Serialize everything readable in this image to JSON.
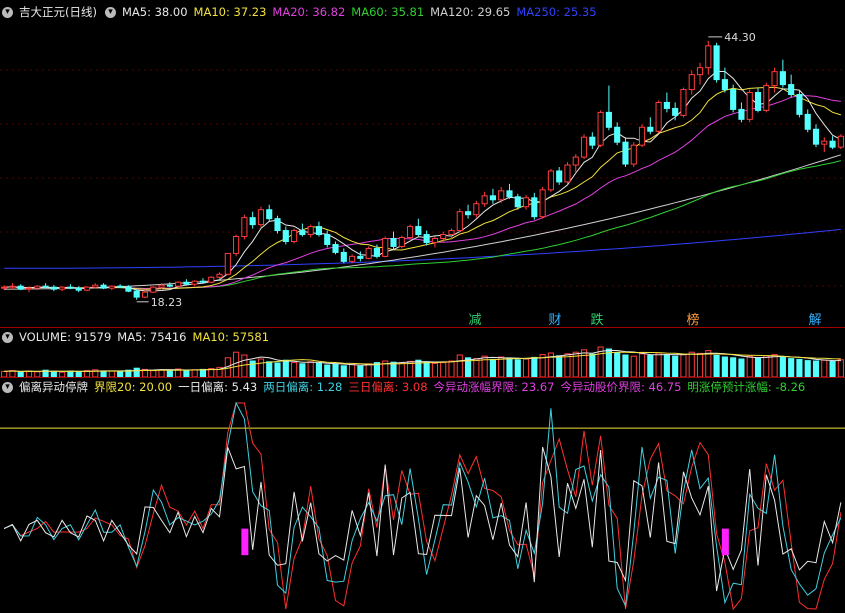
{
  "main_legend": {
    "title": "吉大正元(日线)",
    "items": [
      {
        "text": "MA5: 38.00",
        "color": "#e8e8e8"
      },
      {
        "text": "MA10: 37.23",
        "color": "#f2e23c"
      },
      {
        "text": "MA20: 36.82",
        "color": "#e040e0"
      },
      {
        "text": "MA60: 35.81",
        "color": "#30d030"
      },
      {
        "text": "MA120: 29.65",
        "color": "#cfcfcf"
      },
      {
        "text": "MA250: 25.35",
        "color": "#3040ff"
      }
    ]
  },
  "price_labels": {
    "high": "44.30",
    "low": "18.23"
  },
  "events": [
    {
      "text": "减",
      "color": "#30d070",
      "x": 475
    },
    {
      "text": "财",
      "color": "#30b0ff",
      "x": 555
    },
    {
      "text": "跌",
      "color": "#30d070",
      "x": 597
    },
    {
      "text": "榜",
      "color": "#ff9a40",
      "x": 693
    },
    {
      "text": "解",
      "color": "#30b0ff",
      "x": 815
    }
  ],
  "volume_legend": {
    "items": [
      {
        "text": "VOLUME: 91579",
        "color": "#e8e8e8"
      },
      {
        "text": "MA5: 75416",
        "color": "#e8e8e8"
      },
      {
        "text": "MA10: 57581",
        "color": "#f2e23c"
      }
    ]
  },
  "indicator_legend": {
    "items": [
      {
        "text": "偏离异动停牌",
        "color": "#e8e8e8"
      },
      {
        "text": "界限20: 20.00",
        "color": "#f2e23c"
      },
      {
        "text": "一日偏离: 5.43",
        "color": "#e8e8e8"
      },
      {
        "text": "两日偏离: 1.28",
        "color": "#40d0e0"
      },
      {
        "text": "三日偏离: 3.08",
        "color": "#ff3030"
      },
      {
        "text": "今异动涨幅界限: 23.67",
        "color": "#e040e0"
      },
      {
        "text": "今异动股价界限: 46.75",
        "color": "#e040e0"
      },
      {
        "text": "明涨停预计涨幅: -8.26",
        "color": "#30d030"
      }
    ]
  },
  "chart_data": {
    "type": "candlestick",
    "ylim": [
      17,
      46
    ],
    "candles": [
      [
        19.4,
        19.7,
        19.2,
        19.5
      ],
      [
        19.5,
        19.9,
        19.3,
        19.6
      ],
      [
        19.6,
        19.8,
        19.2,
        19.3
      ],
      [
        19.3,
        19.6,
        19.0,
        19.4
      ],
      [
        19.4,
        19.7,
        19.2,
        19.6
      ],
      [
        19.6,
        19.9,
        19.4,
        19.5
      ],
      [
        19.5,
        19.7,
        19.1,
        19.3
      ],
      [
        19.3,
        19.6,
        19.1,
        19.5
      ],
      [
        19.5,
        19.8,
        19.3,
        19.4
      ],
      [
        19.4,
        19.6,
        19.0,
        19.2
      ],
      [
        19.2,
        19.6,
        19.1,
        19.5
      ],
      [
        19.5,
        19.9,
        19.4,
        19.7
      ],
      [
        19.7,
        19.9,
        19.3,
        19.4
      ],
      [
        19.4,
        19.7,
        19.2,
        19.6
      ],
      [
        19.6,
        19.8,
        19.4,
        19.5
      ],
      [
        19.5,
        19.7,
        19.0,
        19.1
      ],
      [
        19.1,
        19.3,
        18.23,
        18.5
      ],
      [
        18.5,
        19.2,
        18.4,
        19.0
      ],
      [
        19.0,
        19.6,
        18.9,
        19.5
      ],
      [
        19.5,
        19.9,
        19.3,
        19.7
      ],
      [
        19.7,
        20.0,
        19.5,
        19.6
      ],
      [
        19.6,
        20.1,
        19.5,
        20.0
      ],
      [
        20.0,
        20.3,
        19.7,
        19.8
      ],
      [
        19.8,
        20.2,
        19.6,
        20.1
      ],
      [
        20.1,
        20.4,
        19.9,
        20.0
      ],
      [
        20.0,
        20.6,
        19.9,
        20.5
      ],
      [
        20.5,
        21.0,
        20.3,
        20.8
      ],
      [
        20.8,
        22.9,
        20.7,
        22.9
      ],
      [
        22.9,
        24.8,
        22.6,
        24.6
      ],
      [
        24.6,
        26.8,
        24.3,
        26.5
      ],
      [
        26.5,
        27.1,
        25.4,
        25.8
      ],
      [
        25.8,
        27.6,
        25.5,
        27.3
      ],
      [
        27.3,
        27.8,
        26.1,
        26.4
      ],
      [
        26.4,
        26.7,
        24.9,
        25.2
      ],
      [
        25.2,
        25.6,
        23.8,
        24.1
      ],
      [
        24.1,
        25.4,
        23.9,
        25.2
      ],
      [
        25.2,
        25.9,
        24.6,
        24.8
      ],
      [
        24.8,
        25.8,
        24.5,
        25.6
      ],
      [
        25.6,
        26.1,
        24.6,
        24.8
      ],
      [
        24.8,
        25.2,
        23.5,
        23.8
      ],
      [
        23.8,
        24.1,
        22.8,
        23.0
      ],
      [
        23.0,
        23.4,
        21.9,
        22.1
      ],
      [
        22.1,
        22.8,
        21.9,
        22.6
      ],
      [
        22.6,
        23.1,
        22.1,
        22.4
      ],
      [
        22.4,
        23.6,
        22.3,
        23.4
      ],
      [
        23.4,
        23.8,
        22.4,
        22.6
      ],
      [
        22.6,
        24.6,
        22.5,
        24.4
      ],
      [
        24.4,
        25.1,
        23.3,
        23.6
      ],
      [
        23.6,
        24.7,
        23.4,
        24.5
      ],
      [
        24.5,
        25.8,
        24.3,
        25.6
      ],
      [
        25.6,
        26.4,
        24.6,
        24.8
      ],
      [
        24.8,
        25.2,
        23.7,
        24.0
      ],
      [
        24.0,
        24.6,
        23.5,
        24.4
      ],
      [
        24.4,
        25.1,
        24.0,
        24.8
      ],
      [
        24.8,
        25.4,
        24.3,
        25.2
      ],
      [
        25.2,
        27.4,
        25.0,
        27.1
      ],
      [
        27.1,
        27.8,
        26.4,
        26.8
      ],
      [
        26.8,
        28.2,
        26.5,
        27.9
      ],
      [
        27.9,
        29.1,
        27.6,
        28.7
      ],
      [
        28.7,
        29.4,
        27.9,
        28.3
      ],
      [
        28.3,
        29.6,
        28.0,
        29.2
      ],
      [
        29.2,
        29.9,
        28.4,
        28.6
      ],
      [
        28.6,
        28.9,
        27.3,
        27.6
      ],
      [
        27.6,
        28.8,
        27.3,
        28.5
      ],
      [
        28.5,
        29.0,
        26.3,
        26.6
      ],
      [
        26.6,
        29.6,
        26.4,
        29.3
      ],
      [
        29.3,
        31.4,
        29.1,
        31.2
      ],
      [
        31.2,
        31.6,
        29.8,
        30.1
      ],
      [
        30.1,
        32.1,
        29.9,
        31.8
      ],
      [
        31.8,
        32.9,
        31.1,
        32.6
      ],
      [
        32.6,
        34.9,
        32.4,
        34.6
      ],
      [
        34.6,
        35.1,
        33.4,
        33.8
      ],
      [
        33.8,
        37.3,
        33.6,
        37.1
      ],
      [
        37.1,
        39.8,
        35.3,
        35.6
      ],
      [
        35.6,
        36.1,
        33.8,
        34.1
      ],
      [
        34.1,
        34.6,
        31.6,
        31.9
      ],
      [
        31.9,
        34.1,
        31.6,
        33.8
      ],
      [
        33.8,
        35.9,
        33.6,
        35.6
      ],
      [
        35.6,
        36.6,
        34.9,
        35.2
      ],
      [
        35.2,
        38.3,
        35.0,
        38.1
      ],
      [
        38.1,
        39.1,
        37.1,
        37.5
      ],
      [
        37.5,
        38.1,
        36.3,
        36.8
      ],
      [
        36.8,
        39.6,
        36.6,
        39.4
      ],
      [
        39.4,
        41.3,
        38.9,
        40.9
      ],
      [
        40.9,
        42.1,
        39.9,
        41.6
      ],
      [
        41.6,
        44.3,
        40.9,
        43.8
      ],
      [
        43.8,
        44.1,
        40.1,
        40.4
      ],
      [
        40.4,
        41.6,
        39.1,
        39.4
      ],
      [
        39.4,
        39.9,
        37.1,
        37.4
      ],
      [
        37.4,
        38.1,
        36.1,
        36.4
      ],
      [
        36.4,
        39.4,
        36.1,
        39.1
      ],
      [
        39.1,
        39.6,
        37.1,
        37.3
      ],
      [
        37.3,
        40.1,
        37.1,
        39.8
      ],
      [
        39.8,
        41.6,
        39.1,
        41.2
      ],
      [
        41.2,
        42.4,
        39.6,
        39.9
      ],
      [
        39.9,
        40.9,
        38.6,
        38.9
      ],
      [
        38.9,
        39.3,
        36.6,
        36.9
      ],
      [
        36.9,
        37.4,
        35.1,
        35.4
      ],
      [
        35.4,
        35.9,
        33.6,
        33.9
      ],
      [
        33.9,
        34.6,
        33.1,
        34.2
      ],
      [
        34.2,
        34.7,
        33.4,
        33.6
      ],
      [
        33.6,
        34.9,
        33.4,
        34.7
      ]
    ],
    "volume": [
      14,
      16,
      12,
      15,
      13,
      17,
      14,
      12,
      15,
      13,
      16,
      18,
      14,
      15,
      13,
      17,
      22,
      19,
      16,
      18,
      17,
      20,
      16,
      18,
      19,
      21,
      24,
      48,
      62,
      55,
      40,
      45,
      38,
      35,
      42,
      36,
      33,
      38,
      34,
      30,
      32,
      28,
      31,
      27,
      33,
      36,
      40,
      37,
      35,
      39,
      42,
      38,
      34,
      36,
      40,
      55,
      48,
      46,
      52,
      44,
      50,
      47,
      43,
      45,
      49,
      56,
      60,
      53,
      58,
      62,
      68,
      57,
      75,
      70,
      61,
      55,
      52,
      58,
      54,
      60,
      56,
      52,
      57,
      62,
      59,
      66,
      54,
      50,
      48,
      45,
      52,
      47,
      53,
      56,
      49,
      46,
      44,
      41,
      40,
      42,
      39,
      43
    ],
    "indicator": {
      "limit": 20.0,
      "ylim": [
        -16,
        25
      ]
    }
  }
}
